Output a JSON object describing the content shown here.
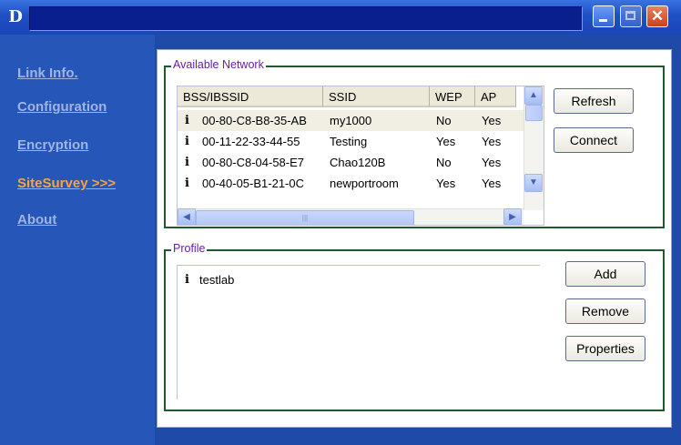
{
  "window": {
    "logo_letter": "D",
    "title": "",
    "accent_color": "#f4a640"
  },
  "sidebar": {
    "items": [
      {
        "label": "Link Info."
      },
      {
        "label": "Configuration"
      },
      {
        "label": "Encryption"
      },
      {
        "label": "SiteSurvey >>>",
        "active": true
      },
      {
        "label": "About"
      }
    ]
  },
  "available_network": {
    "legend": "Available Network",
    "columns": [
      "BSS/IBSSID",
      "SSID",
      "WEP",
      "AP"
    ],
    "rows": [
      {
        "bssid": "00-80-C8-B8-35-AB",
        "ssid": "my1000",
        "wep": "No",
        "ap": "Yes",
        "selected": true
      },
      {
        "bssid": "00-11-22-33-44-55",
        "ssid": "Testing",
        "wep": "Yes",
        "ap": "Yes"
      },
      {
        "bssid": "00-80-C8-04-58-E7",
        "ssid": "Chao120B",
        "wep": "No",
        "ap": "Yes"
      },
      {
        "bssid": "00-40-05-B1-21-0C",
        "ssid": "newportroom",
        "wep": "Yes",
        "ap": "Yes"
      }
    ],
    "icon_glyph": "i",
    "refresh_label": "Refresh",
    "connect_label": "Connect"
  },
  "profile": {
    "legend": "Profile",
    "items": [
      {
        "name": "testlab"
      }
    ],
    "add_label": "Add",
    "remove_label": "Remove",
    "properties_label": "Properties"
  },
  "icons": {
    "scroll_up": "▲",
    "scroll_down": "▼",
    "scroll_left": "◀",
    "scroll_right": "▶",
    "close": "✕",
    "thumb_grip": "|||"
  }
}
